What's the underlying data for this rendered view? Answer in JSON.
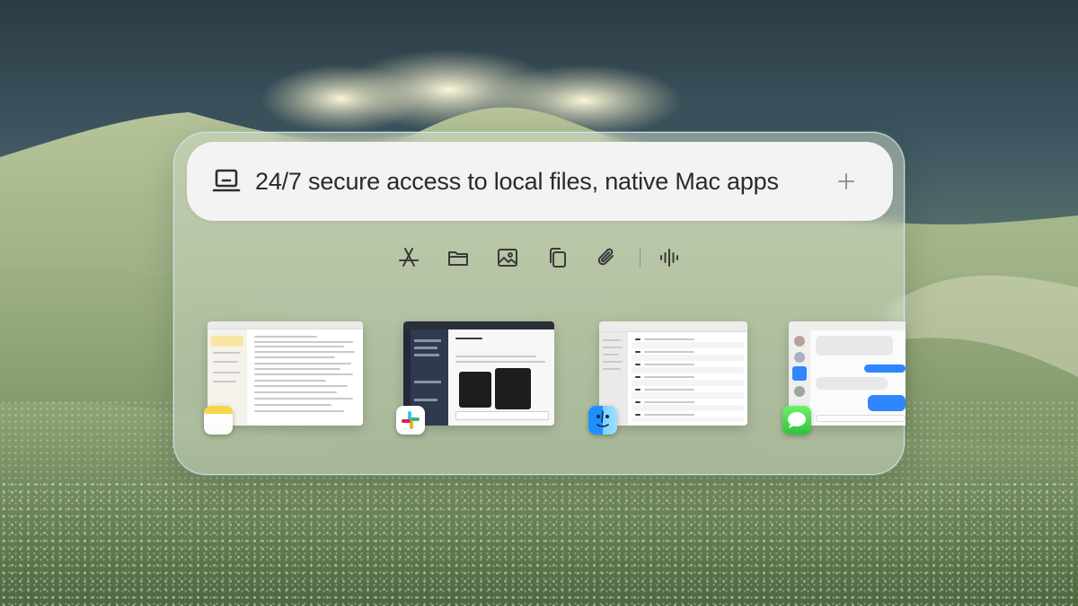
{
  "search": {
    "text": "24/7 secure access to local files, native Mac apps",
    "leading_icon": "laptop-icon",
    "trailing_icon": "plus-icon"
  },
  "toolbar": {
    "icons": [
      "app-store-icon",
      "folder-icon",
      "image-icon",
      "copy-icon",
      "paperclip-icon",
      "audio-waveform-icon"
    ]
  },
  "apps": [
    {
      "name": "Notes",
      "icon": "notes-icon"
    },
    {
      "name": "Slack",
      "icon": "slack-icon"
    },
    {
      "name": "Finder",
      "icon": "finder-icon"
    },
    {
      "name": "Messages",
      "icon": "messages-icon"
    }
  ],
  "colors": {
    "panel_border": "#cfe9ee",
    "search_bg": "#f3f3f1",
    "icon_stroke": "#3a3a3a",
    "slack_sidebar": "#2f3a4e",
    "messages_bubble": "#2f86ff"
  }
}
